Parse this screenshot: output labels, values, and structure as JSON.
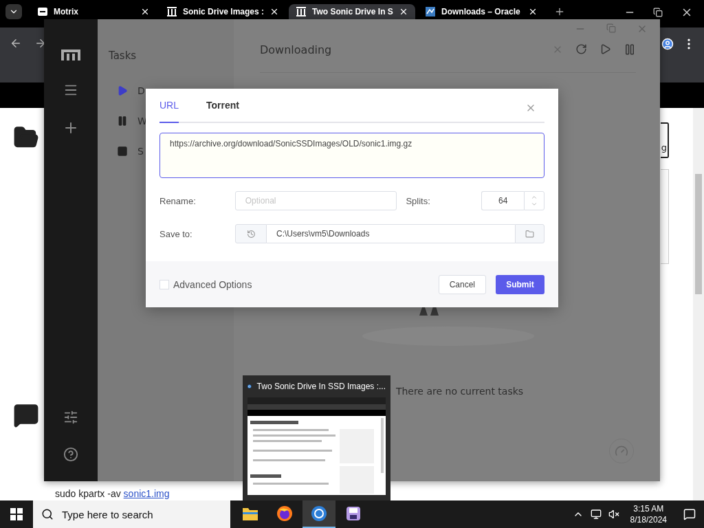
{
  "browser": {
    "tabs": [
      {
        "title": "Motrix",
        "kind": "motrix",
        "selected": false
      },
      {
        "title": "Sonic Drive Images :",
        "kind": "archive",
        "selected": false
      },
      {
        "title": "Two Sonic Drive In S",
        "kind": "archive",
        "selected": true
      },
      {
        "title": "Downloads – Oracle",
        "kind": "vbox",
        "selected": false
      }
    ]
  },
  "page": {
    "side_text": "g",
    "command": "sudo kpartx -av ",
    "command_link": "sonic1.img"
  },
  "motrix": {
    "subnav": {
      "title": "Tasks",
      "items": [
        {
          "label": "D",
          "kind": "play",
          "selected": true
        },
        {
          "label": "W",
          "kind": "pause",
          "selected": false
        },
        {
          "label": "S",
          "kind": "stop",
          "selected": false
        }
      ]
    },
    "main": {
      "title": "Downloading",
      "empty_text": "There are no current tasks"
    }
  },
  "dialog": {
    "tabs": [
      {
        "label": "URL",
        "selected": true
      },
      {
        "label": "Torrent",
        "selected": false
      }
    ],
    "url": "https://archive.org/download/SonicSSDImages/OLD/sonic1.img.gz",
    "rename_label": "Rename:",
    "rename_placeholder": "Optional",
    "splits_label": "Splits:",
    "splits": "64",
    "save_label": "Save to:",
    "save_path": "C:\\Users\\vm5\\Downloads",
    "advanced": {
      "label": "Advanced Options",
      "checked": false
    },
    "cancel": "Cancel",
    "submit": "Submit"
  },
  "preview": {
    "title": "Two Sonic Drive In SSD Images :..."
  },
  "taskbar": {
    "search_placeholder": "Type here to search",
    "apps": [
      {
        "kind": "explorer",
        "selected": false
      },
      {
        "kind": "firefox",
        "selected": false
      },
      {
        "kind": "chrome",
        "selected": true
      },
      {
        "kind": "floppy",
        "selected": false
      }
    ],
    "time": "3:15 AM",
    "date": "8/18/2024"
  }
}
